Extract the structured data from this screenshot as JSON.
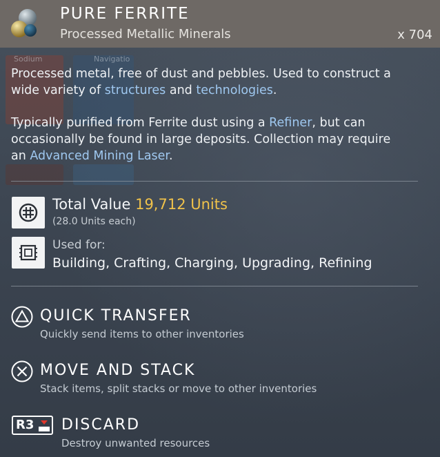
{
  "item": {
    "name": "PURE FERRITE",
    "category": "Processed Metallic Minerals",
    "quantity": "x 704"
  },
  "description": {
    "p1_a": "Processed metal, free of dust and pebbles. Used to construct a",
    "p1_b": "wide variety of ",
    "p1_kw1": "structures",
    "p1_c": " and ",
    "p1_kw2": "technologies",
    "p1_d": ".",
    "p2_a": "Typically purified from Ferrite dust using a ",
    "p2_kw1": "Refiner",
    "p2_b": ", but can",
    "p2_c": "occasionally be found in large deposits. Collection may require",
    "p2_d": "an ",
    "p2_kw2": "Advanced Mining Laser",
    "p2_e": "."
  },
  "value": {
    "label": "Total Value ",
    "amount": "19,712 Units",
    "each": "(28.0 Units each)",
    "icon": "units-currency-icon"
  },
  "used_for": {
    "label": "Used for:",
    "list": "Building, Crafting, Charging, Upgrading, Refining",
    "icon": "chip-icon"
  },
  "actions": [
    {
      "title": "QUICK TRANSFER",
      "desc": "Quickly send items to other inventories",
      "icon": "triangle-button-icon"
    },
    {
      "title": "MOVE AND STACK",
      "desc": "Stack items, split stacks or move to other inventories",
      "icon": "cross-button-icon"
    },
    {
      "title": "DISCARD",
      "desc": "Destroy unwanted resources",
      "button": "R3",
      "icon": "r3-button-icon"
    }
  ],
  "background_slots": {
    "slot_a": "Sodium",
    "slot_b": "Navigatio"
  },
  "colors": {
    "header_bg": "#6e6965",
    "keyword": "#9fc8f0",
    "value_amount": "#f0c24a",
    "panel_bg": "#3a4350"
  }
}
